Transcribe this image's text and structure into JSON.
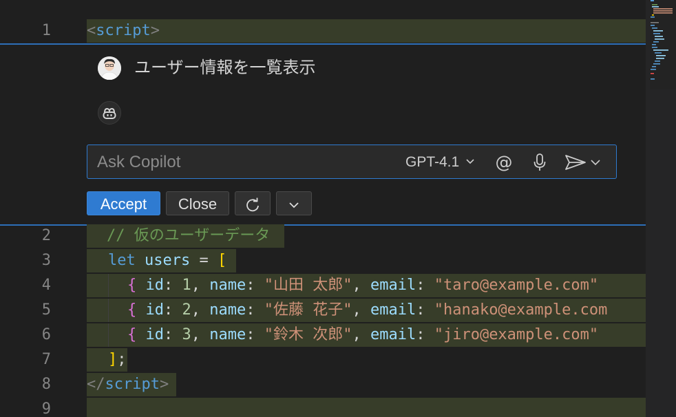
{
  "editor": {
    "line1": {
      "number": "1",
      "open": "<",
      "name": "script",
      "close": ">"
    },
    "line2": {
      "number": "2",
      "comment": "// 仮のユーザーデータ"
    },
    "line3": {
      "number": "3",
      "kw": "let",
      "var": "users",
      "op": " = ",
      "bracket": "["
    },
    "rows": [
      {
        "number": "4",
        "brace": "{",
        "id_key": "id",
        "id_val": "1",
        "name_key": "name",
        "name_val": "\"山田 太郎\"",
        "email_key": "email",
        "email_val": "\"taro@example.com\""
      },
      {
        "number": "5",
        "brace": "{",
        "id_key": "id",
        "id_val": "2",
        "name_key": "name",
        "name_val": "\"佐藤 花子\"",
        "email_key": "email",
        "email_val": "\"hanako@example.com"
      },
      {
        "number": "6",
        "brace": "{",
        "id_key": "id",
        "id_val": "3",
        "name_key": "name",
        "name_val": "\"鈴木 次郎\"",
        "email_key": "email",
        "email_val": "\"jiro@example.com\""
      }
    ],
    "line7": {
      "number": "7",
      "bracket": "]",
      "semi": ";"
    },
    "line8": {
      "number": "8",
      "open": "</",
      "name": "script",
      "close": ">"
    },
    "line9": {
      "number": "9"
    }
  },
  "chat": {
    "user_prompt": "ユーザー情報を一覧表示",
    "input_placeholder": "Ask Copilot",
    "model": "GPT-4.1",
    "mention_label": "@",
    "accept_label": "Accept",
    "close_label": "Close"
  },
  "colors": {
    "accent": "#2f7bd1",
    "diff_highlight": "#373d29"
  },
  "icons": [
    "user-avatar",
    "copilot-icon",
    "chevron-down-icon",
    "mic-icon",
    "send-icon",
    "refresh-icon"
  ]
}
